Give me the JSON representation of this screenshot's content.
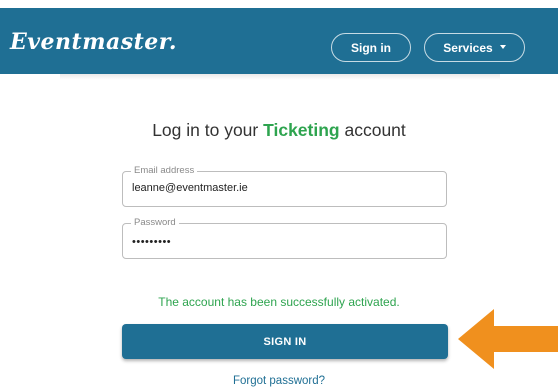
{
  "navbar": {
    "logo": "Eventmaster.",
    "signin_label": "Sign in",
    "services_label": "Services"
  },
  "heading": {
    "prefix": "Log in to your ",
    "accent": "Ticketing",
    "suffix": " account"
  },
  "form": {
    "email": {
      "label": "Email address",
      "value": "leanne@eventmaster.ie"
    },
    "password": {
      "label": "Password",
      "value": "•••••••••"
    },
    "success_message": "The account has been successfully activated.",
    "submit_label": "SIGN IN",
    "forgot_label": "Forgot password?"
  },
  "colors": {
    "brand": "#1f6f94",
    "success": "#2ea44f",
    "arrow": "#f0901e"
  },
  "icons": {
    "services_caret": "chevron-down-icon",
    "pointer": "arrow-left-icon"
  }
}
